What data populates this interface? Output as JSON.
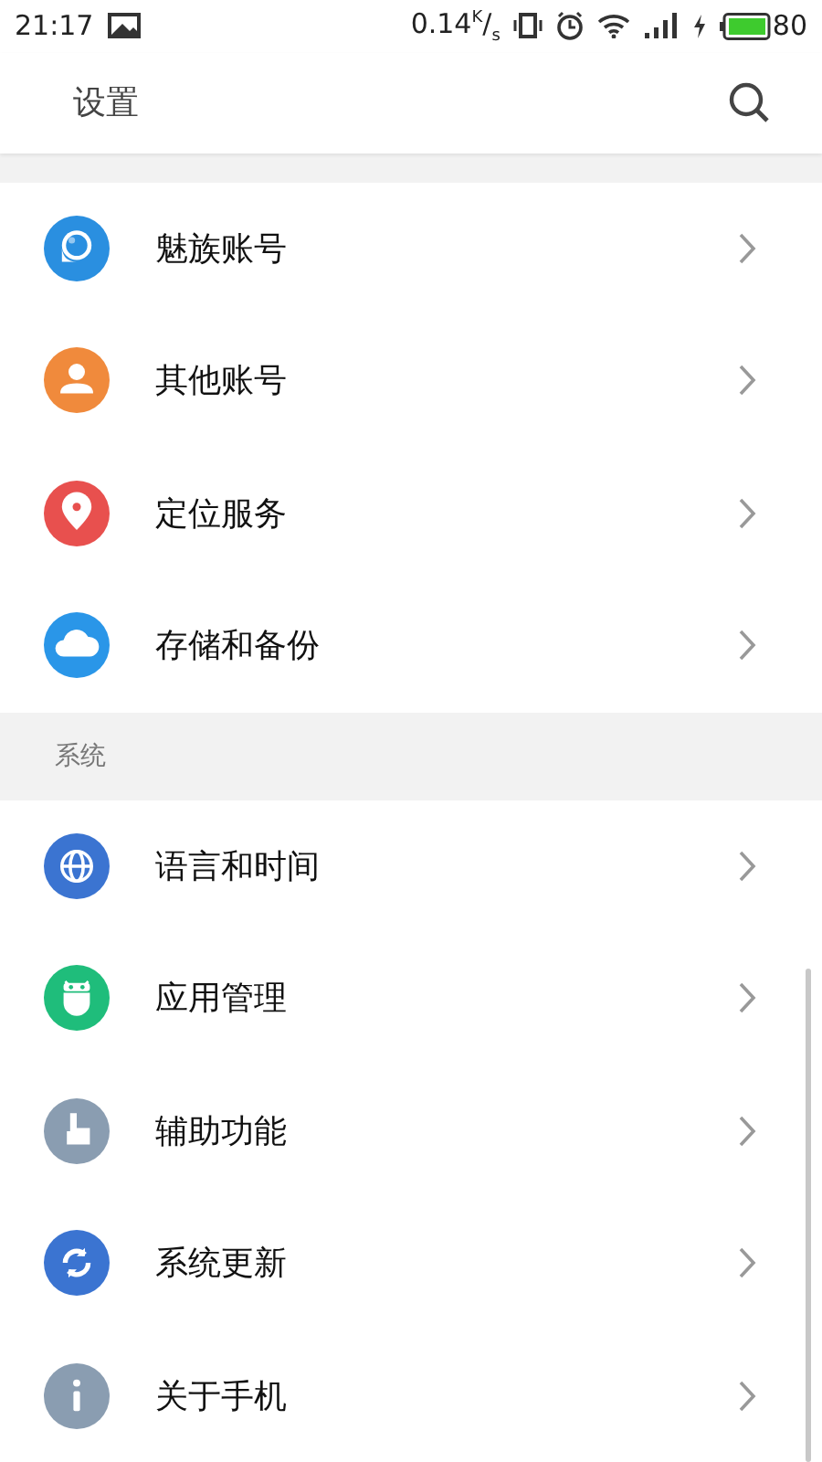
{
  "status_bar": {
    "time": "21:17",
    "speed": "0.14$^{K}$/$_{s}$",
    "battery": "80"
  },
  "header": {
    "title": "设置"
  },
  "sections": [
    {
      "items": [
        {
          "label": "魅族账号",
          "color": "#2a8fe0"
        },
        {
          "label": "其他账号",
          "color": "#f08a3c"
        },
        {
          "label": "定位服务",
          "color": "#e8504e"
        },
        {
          "label": "存储和备份",
          "color": "#2a96e8"
        }
      ]
    },
    {
      "label": "系统",
      "items": [
        {
          "label": "语言和时间",
          "color": "#3b74d1"
        },
        {
          "label": "应用管理",
          "color": "#1fbd7b"
        },
        {
          "label": "辅助功能",
          "color": "#8a9db1"
        },
        {
          "label": "系统更新",
          "color": "#3b74d1"
        },
        {
          "label": "关于手机",
          "color": "#8a9db1"
        }
      ]
    }
  ]
}
